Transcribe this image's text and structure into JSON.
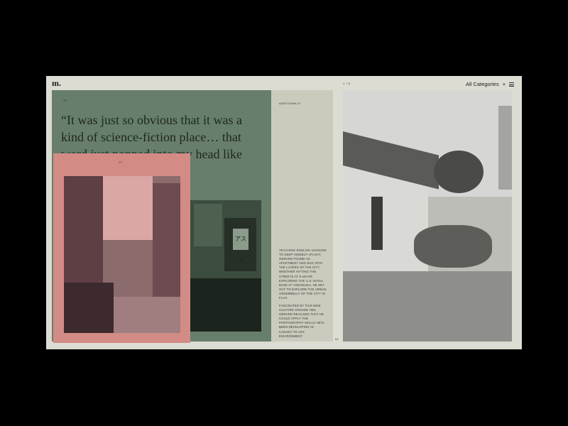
{
  "header": {
    "logo": "m.",
    "page_indicator": "1 / 6",
    "category_label": "All Categories",
    "category_plus": "+"
  },
  "left_panel": {
    "index_label": "3/7",
    "quote": "“It was just so obvious that it was a kind of science-fiction place… that word just popped into my head like you’re on the train"
  },
  "card": {
    "index_label": "1/7"
  },
  "text_column": {
    "heading": "ADDITIONALLY",
    "paragraph_1": "TEACHING ENGLISH LESSONS TO KEEP HIMSELF AFLOAT, GERARD FOUND AN APARTMENT AND DUG INTO THE LAYERS OF THE CITY. WHETHER HITTING THE STREETS AT 6 AM OR EXPLORING THE U.S. NAVAL BASE AT YOKOSUKA, HE SET OUT TO EXPLORE THE URBAN UNDERBELLY OF THE CITY IN FLUX.",
    "paragraph_2": "FASCINATED BY THIS NEW CULTURE AROUND HIM, GERARD REALISED THAT HE COULD APPLY THE PHOTOGRAPHY SKILLS HE’D BEEN DEVELOPING IN CANADA TO ANY ENVIRONMENT.",
    "page_number": "02"
  },
  "street_photo": {
    "sign_text": "アスペ"
  },
  "colors": {
    "background": "#000000",
    "frame": "#dcdcd3",
    "green_panel": "#677f6a",
    "pink_card": "#d38b86",
    "text_column": "#cbcbbd"
  }
}
